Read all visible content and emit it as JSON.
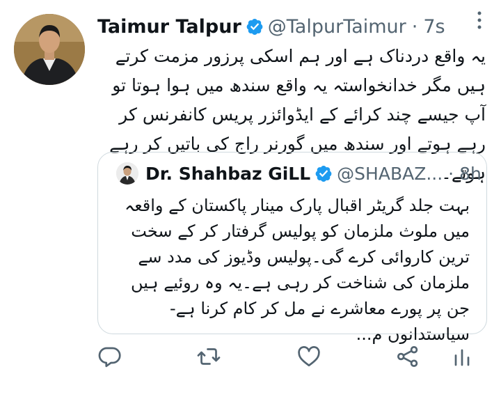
{
  "tweet": {
    "author_name": "Taimur Talpur",
    "handle": "@TalpurTaimur",
    "separator": "·",
    "time": "7s",
    "text": "یہ واقع دردناک ہے اور ہم اسکی پرزور مزمت کرتے ہیں مگر خدانخواستہ یہ واقع سندھ میں ہوا ہوتا تو آپ جیسے چند کرائے کے ایڈوائزر پریس کانفرنس کر رہے ہوتے اور سندھ میں گورنر راج کی باتیں کر رہے ہوتے۔"
  },
  "quoted": {
    "author_name": "Dr. Shahbaz GiLL",
    "handle": "@SHABAZ...",
    "separator": "·",
    "time": "8h",
    "text": "بہت جلد گریٹر اقبال پارک مینار پاکستان کے واقعہ میں ملوث ملزمان کو پولیس گرفتار کر کے سخت ترین کاروائی کرے گی۔پولیس وڈیوز کی مدد سے ملزمان کی شناخت کر رہی ہے۔یہ وہ روئیے ہیں جن پر پورے معاشرے نے مل کر کام کرنا ہے-سیاستدانوں م..."
  },
  "colors": {
    "verified": "#1d9bf0",
    "secondary_text": "#536471",
    "border": "#cfd9de"
  },
  "icons": [
    "verified-icon",
    "more-icon",
    "reply-icon",
    "retweet-icon",
    "like-icon",
    "share-icon",
    "analytics-icon"
  ]
}
